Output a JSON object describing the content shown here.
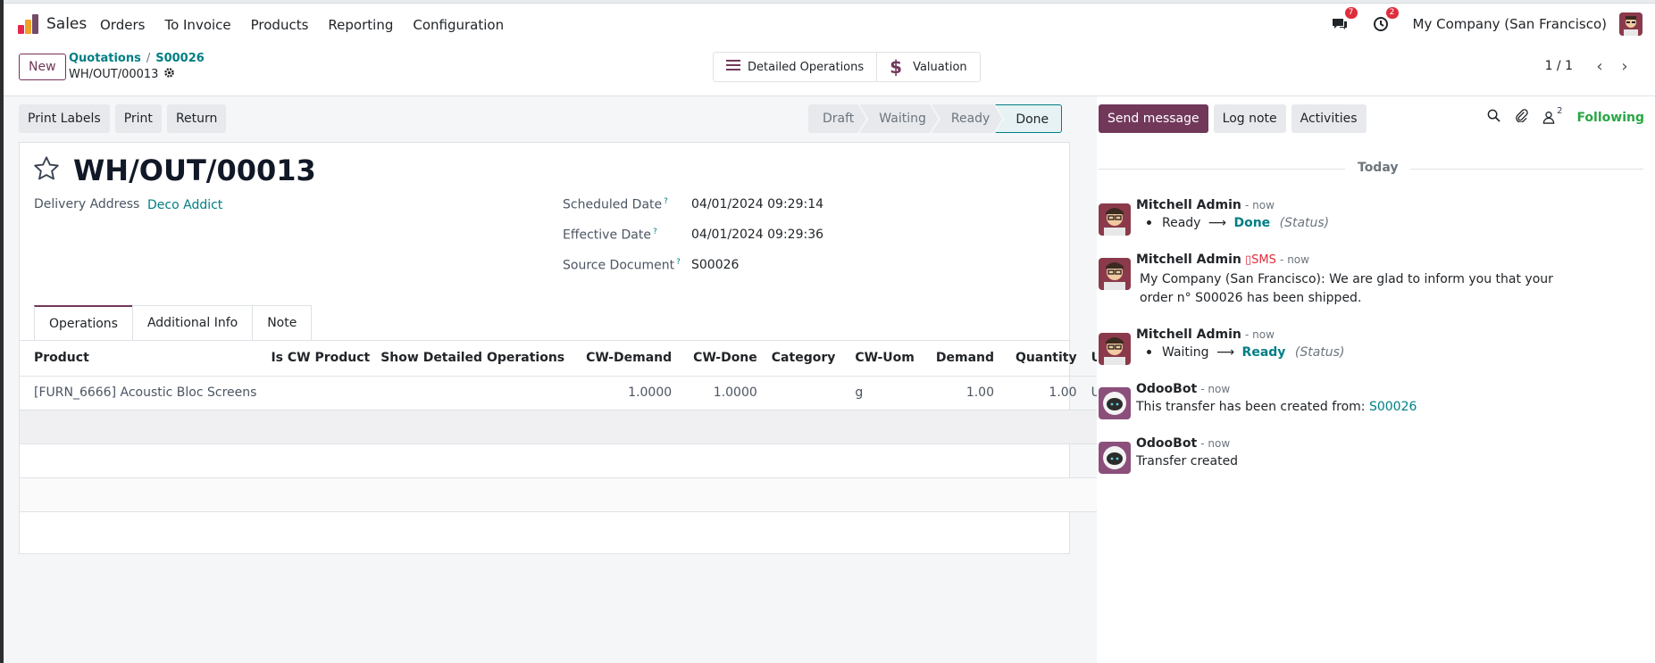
{
  "nav": {
    "app_name": "Sales",
    "menu": [
      "Orders",
      "To Invoice",
      "Products",
      "Reporting",
      "Configuration"
    ],
    "messages_count": "7",
    "activities_count": "2",
    "company": "My Company (San Francisco)"
  },
  "control": {
    "new_label": "New",
    "breadcrumb_1": "Quotations",
    "breadcrumb_sep": "/",
    "breadcrumb_2": "S00026",
    "current": "WH/OUT/00013",
    "smart_detailed": "Detailed Operations",
    "smart_valuation": "Valuation",
    "pager": "1 / 1"
  },
  "actions": {
    "print_labels": "Print Labels",
    "print": "Print",
    "return": "Return"
  },
  "statusbar": {
    "stages": [
      "Draft",
      "Waiting",
      "Ready",
      "Done"
    ],
    "active": "Done"
  },
  "form": {
    "title": "WH/OUT/00013",
    "delivery_address_label": "Delivery Address",
    "delivery_address": "Deco Addict",
    "scheduled_date_label": "Scheduled Date",
    "scheduled_date": "04/01/2024 09:29:14",
    "effective_date_label": "Effective Date",
    "effective_date": "04/01/2024 09:29:36",
    "source_document_label": "Source Document",
    "source_document": "S00026",
    "help_mark": "?"
  },
  "tabs": [
    "Operations",
    "Additional Info",
    "Note"
  ],
  "table": {
    "headers": [
      "Product",
      "Is CW Product",
      "Show Detailed Operations",
      "CW-Demand",
      "CW-Done",
      "Category",
      "CW-Uom",
      "Demand",
      "Quantity",
      "Unit"
    ],
    "row": {
      "product": "[FURN_6666] Acoustic Bloc Screens",
      "is_cw": "",
      "show_detailed": "",
      "cw_demand": "1.0000",
      "cw_done": "1.0000",
      "category": "",
      "cw_uom": "g",
      "demand": "1.00",
      "quantity": "1.00",
      "unit": "Units"
    }
  },
  "chatter": {
    "send_message": "Send message",
    "log_note": "Log note",
    "activities": "Activities",
    "followers_count": "2",
    "following": "Following",
    "today": "Today",
    "messages": [
      {
        "author": "Mitchell Admin",
        "time": "- now",
        "old": "Ready",
        "arrow": "⟶",
        "new": "Done",
        "tag": "(Status)"
      },
      {
        "author": "Mitchell Admin",
        "sms": "SMS",
        "time": "- now",
        "text": "My Company (San Francisco): We are glad to inform you that your order n° S00026 has been shipped."
      },
      {
        "author": "Mitchell Admin",
        "time": "- now",
        "old": "Waiting",
        "arrow": "⟶",
        "new": "Ready",
        "tag": "(Status)"
      },
      {
        "author": "OdooBot",
        "time": "- now",
        "text": "This transfer has been created from:",
        "link": "S00026"
      },
      {
        "author": "OdooBot",
        "time": "- now",
        "text": "Transfer created"
      }
    ]
  },
  "colors": {
    "primary": "#71385a",
    "link": "#017e84",
    "badge": "#e02d3c",
    "following": "#28a745"
  }
}
